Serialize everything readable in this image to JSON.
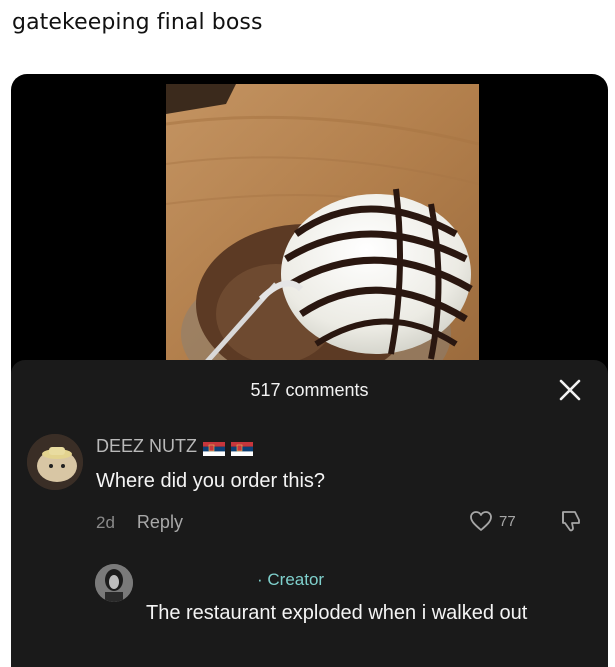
{
  "post": {
    "caption": "gatekeeping final boss"
  },
  "comments_sheet": {
    "count_label": "517 comments",
    "close_icon": "close-icon"
  },
  "comment": {
    "username": "DEEZ NUTZ",
    "flag_icons": [
      "serbia-flag-icon",
      "serbia-flag-icon"
    ],
    "text": "Where did you order this?",
    "time": "2d",
    "reply_label": "Reply",
    "like_count": "77",
    "like_icon": "heart-icon",
    "dislike_icon": "thumbs-down-icon"
  },
  "reply": {
    "creator_label": "· Creator",
    "text": "The restaurant exploded when i walked out"
  },
  "colors": {
    "sheet_bg": "#1a1a1a",
    "creator_accent": "#7fd0cc",
    "muted_text": "#8a8a8a"
  }
}
